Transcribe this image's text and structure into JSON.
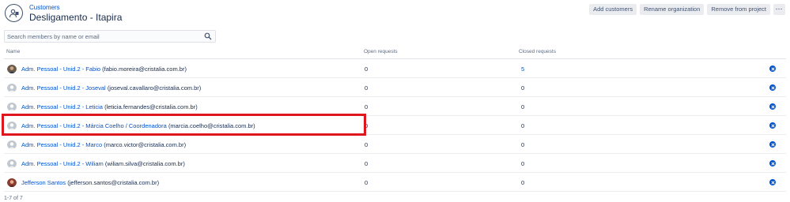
{
  "header": {
    "breadcrumb": "Customers",
    "title": "Desligamento - Itapira",
    "actions": {
      "add_customers": "Add customers",
      "rename_organization": "Rename organization",
      "remove_from_project": "Remove from project",
      "more": "···"
    }
  },
  "search": {
    "placeholder": "Search members by name or email",
    "value": ""
  },
  "table": {
    "columns": {
      "name": "Name",
      "open": "Open requests",
      "closed": "Closed requests"
    },
    "rows": [
      {
        "name": "Adm. Pessoal - Unid.2 - Fabio",
        "email": "(fabio.moreira@cristalia.com.br)",
        "open": "0",
        "closed": "5",
        "avatar": "photo-dark"
      },
      {
        "name": "Adm. Pessoal - Unid.2 - Joseval",
        "email": "(joseval.cavallaro@cristalia.com.br)",
        "open": "0",
        "closed": "0",
        "avatar": "default-user"
      },
      {
        "name": "Adm. Pessoal - Unid.2 - Leticia",
        "email": "(leticia.fernandes@cristalia.com.br)",
        "open": "0",
        "closed": "0",
        "avatar": "default-user"
      },
      {
        "name": "Adm. Pessoal - Unid.2 - Márcia Coelho / Coordenadora",
        "email": "(marcia.coelho@cristalia.com.br)",
        "open": "0",
        "closed": "0",
        "avatar": "default-user"
      },
      {
        "name": "Adm. Pessoal - Unid.2 - Marco",
        "email": "(marco.victor@cristalia.com.br)",
        "open": "0",
        "closed": "0",
        "avatar": "default-user"
      },
      {
        "name": "Adm. Pessoal - Unid.2 - Wiliam",
        "email": "(wiliam.silva@cristalia.com.br)",
        "open": "0",
        "closed": "0",
        "avatar": "default-user"
      },
      {
        "name": "Jefferson Santos",
        "email": "(jefferson.santos@cristalia.com.br)",
        "open": "0",
        "closed": "0",
        "avatar": "photo-red"
      }
    ]
  },
  "pagination": "1-7 of 7",
  "colors": {
    "link": "#0052cc",
    "highlight": "#e0161e",
    "button_bg": "#ebecf0"
  }
}
